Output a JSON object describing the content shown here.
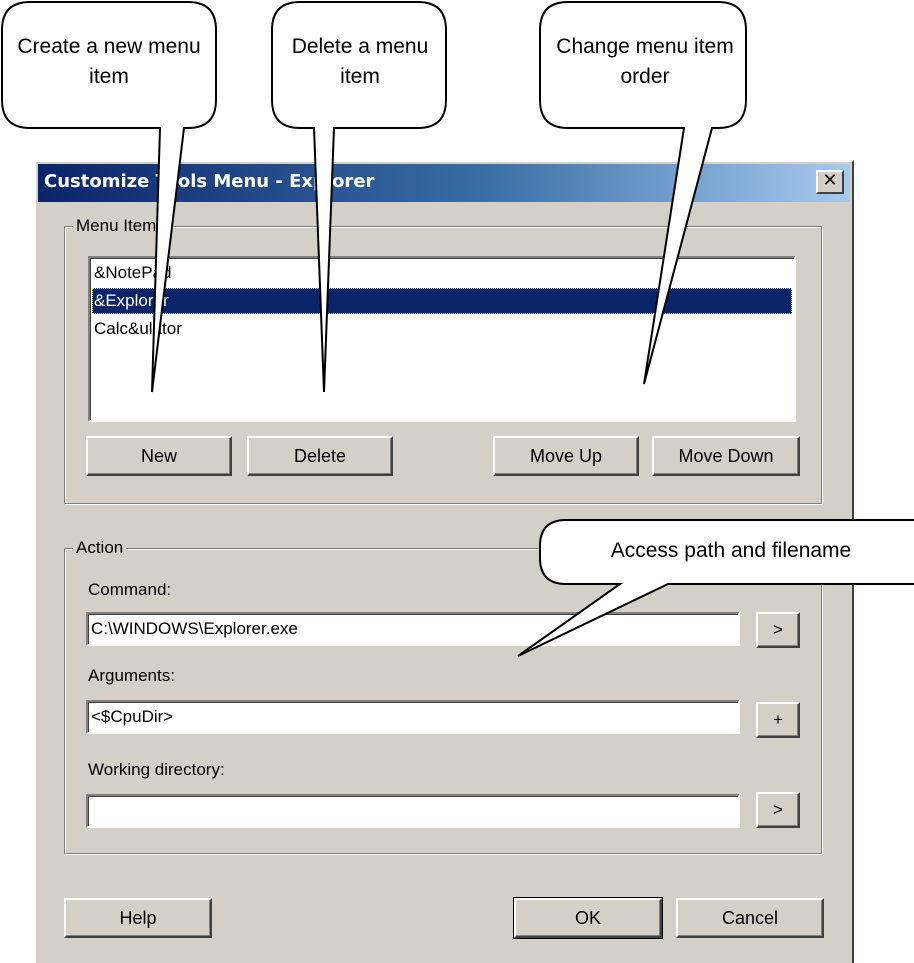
{
  "window": {
    "title": "Customize Tools Menu - Explorer"
  },
  "menu_items_group": {
    "label": "Menu Items",
    "items": [
      "&NotePad",
      "&Explorer",
      "Calc&ulator"
    ],
    "selected_index": 1,
    "buttons": {
      "new": "New",
      "delete": "Delete",
      "move_up": "Move Up",
      "move_down": "Move Down"
    }
  },
  "action_group": {
    "label": "Action",
    "command": {
      "label": "Command:",
      "value": "C:\\WINDOWS\\Explorer.exe",
      "button": ">"
    },
    "arguments": {
      "label": "Arguments:",
      "value": "<$CpuDir>",
      "button": "+"
    },
    "working_directory": {
      "label": "Working directory:",
      "value": "",
      "button": ">"
    }
  },
  "footer": {
    "help": "Help",
    "ok": "OK",
    "cancel": "Cancel"
  },
  "callouts": {
    "new": "Create a new menu item",
    "delete": "Delete a menu item",
    "order": "Change menu item order",
    "path": "Access path and filename"
  }
}
